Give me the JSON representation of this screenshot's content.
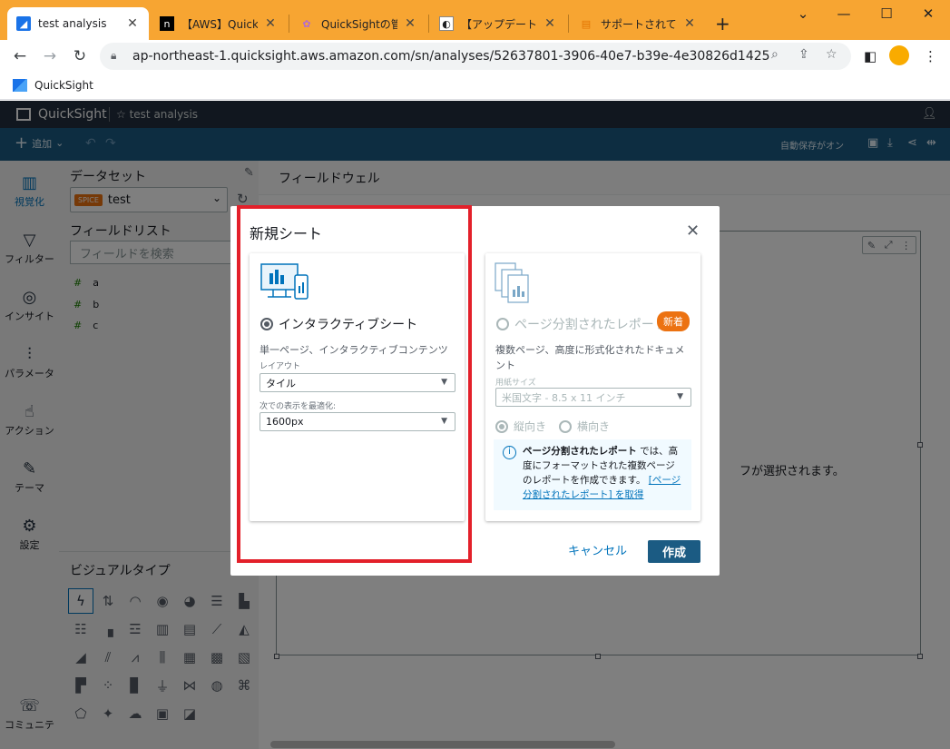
{
  "browser": {
    "tabs": [
      {
        "title": "test analysis",
        "active": true
      },
      {
        "title": "【AWS】QuickSigh"
      },
      {
        "title": "QuickSightの管理"
      },
      {
        "title": "【アップデート】Ama"
      },
      {
        "title": "サポートされている"
      }
    ],
    "url": "ap-northeast-1.quicksight.aws.amazon.com/sn/analyses/52637801-3906-40e7-b39e-4e30826d1425",
    "bookmark": "QuickSight"
  },
  "app": {
    "logo": "QuickSight",
    "analysis_name": "test analysis",
    "toolbar": {
      "add_label": "追加",
      "autosave": "自動保存がオン"
    },
    "leftnav": [
      {
        "label": "視覚化",
        "icon": "visualize-icon",
        "glyph": "▥"
      },
      {
        "label": "フィルター",
        "icon": "filter-icon",
        "glyph": "▽"
      },
      {
        "label": "インサイト",
        "icon": "insight-icon",
        "glyph": "◎"
      },
      {
        "label": "パラメータ",
        "icon": "parameter-icon",
        "glyph": "⫶"
      },
      {
        "label": "アクション",
        "icon": "action-icon",
        "glyph": "☝"
      },
      {
        "label": "テーマ",
        "icon": "theme-icon",
        "glyph": "✎"
      },
      {
        "label": "設定",
        "icon": "settings-icon",
        "glyph": "⚙"
      },
      {
        "label": "コミュニテ",
        "icon": "community-icon",
        "glyph": "☏"
      }
    ],
    "dataset": {
      "title": "データセット",
      "spice": "SPICE",
      "name": "test"
    },
    "fieldlist": {
      "title": "フィールドリスト",
      "search_placeholder": "フィールドを検索",
      "fields": [
        "a",
        "b",
        "c"
      ]
    },
    "visual_types_title": "ビジュアルタイプ",
    "fieldwell_title": "フィールドウェル",
    "canvas_hint": "フが選択されます。"
  },
  "modal": {
    "title": "新規シート",
    "interactive": {
      "label": "インタラクティブシート",
      "description": "単一ページ、インタラクティブコンテンツ",
      "layout_label": "レイアウト",
      "layout_value": "タイル",
      "optimize_label": "次での表示を最適化:",
      "optimize_value": "1600px",
      "selected": true
    },
    "paginated": {
      "label": "ページ分割されたレポート",
      "badge": "新着",
      "description": "複数ページ、高度に形式化されたドキュメント",
      "paper_label": "用紙サイズ",
      "paper_value": "米国文字 - 8.5 x 11 インチ",
      "portrait": "縦向き",
      "landscape": "横向き",
      "info_bold": "ページ分割されたレポート",
      "info_text": "では、高度にフォーマットされた複数ページのレポートを作成できます。",
      "info_link": "[ページ分割されたレポート] を取得"
    },
    "cancel": "キャンセル",
    "create": "作成"
  }
}
